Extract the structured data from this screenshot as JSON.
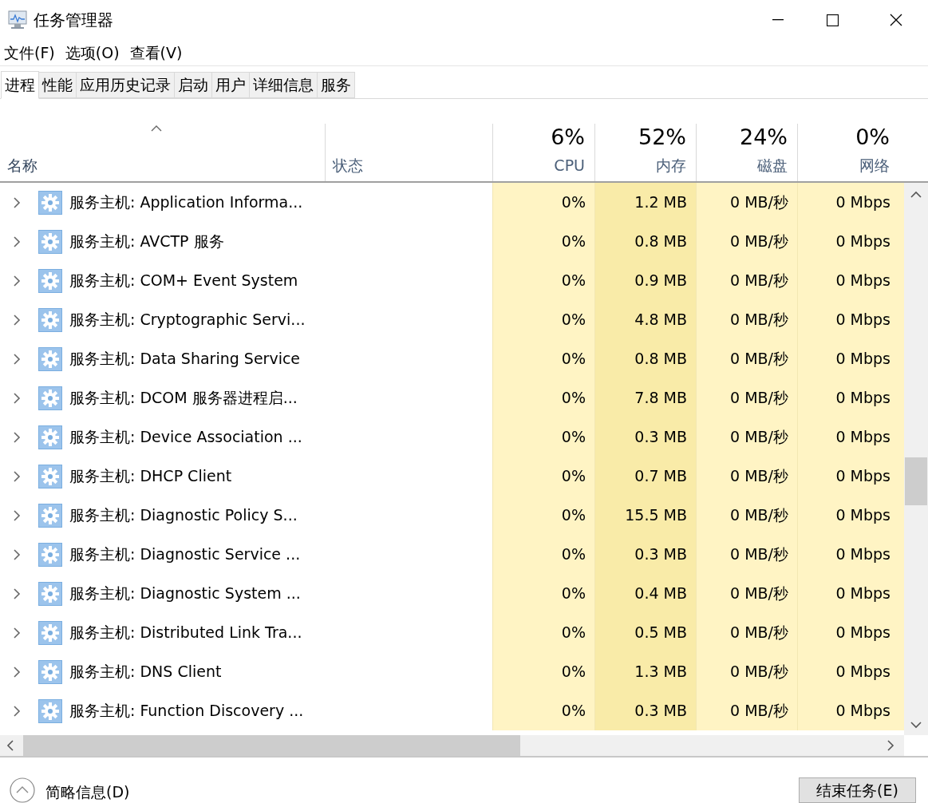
{
  "window": {
    "title": "任务管理器"
  },
  "menu": [
    "文件(F)",
    "选项(O)",
    "查看(V)"
  ],
  "tabs": [
    {
      "label": "进程",
      "selected": true
    },
    {
      "label": "性能",
      "selected": false
    },
    {
      "label": "应用历史记录",
      "selected": false
    },
    {
      "label": "启动",
      "selected": false
    },
    {
      "label": "用户",
      "selected": false
    },
    {
      "label": "详细信息",
      "selected": false
    },
    {
      "label": "服务",
      "selected": false
    }
  ],
  "columns": [
    {
      "kind": "name",
      "label": "名称",
      "sorted": true
    },
    {
      "kind": "status",
      "label": "状态",
      "sorted": false
    },
    {
      "kind": "metric",
      "total": "6%",
      "label": "CPU",
      "sorted": false,
      "color": "#fff4c4"
    },
    {
      "kind": "metric",
      "total": "52%",
      "label": "内存",
      "sorted": false,
      "color": "#f9eba8"
    },
    {
      "kind": "metric",
      "total": "24%",
      "label": "磁盘",
      "sorted": false,
      "color": "#fff4c4"
    },
    {
      "kind": "metric",
      "total": "0%",
      "label": "网络",
      "sorted": false,
      "color": "#fff4c4"
    }
  ],
  "rows": [
    {
      "name": "服务主机: Application Informa...",
      "expanded": false,
      "cells": [
        "0%",
        "1.2 MB",
        "0 MB/秒",
        "0 Mbps"
      ]
    },
    {
      "name": "服务主机: AVCTP 服务",
      "expanded": false,
      "cells": [
        "0%",
        "0.8 MB",
        "0 MB/秒",
        "0 Mbps"
      ]
    },
    {
      "name": "服务主机: COM+ Event System",
      "expanded": false,
      "cells": [
        "0%",
        "0.9 MB",
        "0 MB/秒",
        "0 Mbps"
      ]
    },
    {
      "name": "服务主机: Cryptographic Servi...",
      "expanded": false,
      "cells": [
        "0%",
        "4.8 MB",
        "0 MB/秒",
        "0 Mbps"
      ]
    },
    {
      "name": "服务主机: Data Sharing Service",
      "expanded": false,
      "cells": [
        "0%",
        "0.8 MB",
        "0 MB/秒",
        "0 Mbps"
      ]
    },
    {
      "name": "服务主机: DCOM 服务器进程启...",
      "expanded": false,
      "cells": [
        "0%",
        "7.8 MB",
        "0 MB/秒",
        "0 Mbps"
      ]
    },
    {
      "name": "服务主机: Device Association ...",
      "expanded": false,
      "cells": [
        "0%",
        "0.3 MB",
        "0 MB/秒",
        "0 Mbps"
      ]
    },
    {
      "name": "服务主机: DHCP Client",
      "expanded": false,
      "cells": [
        "0%",
        "0.7 MB",
        "0 MB/秒",
        "0 Mbps"
      ]
    },
    {
      "name": "服务主机: Diagnostic Policy S...",
      "expanded": false,
      "cells": [
        "0%",
        "15.5 MB",
        "0 MB/秒",
        "0 Mbps"
      ]
    },
    {
      "name": "服务主机: Diagnostic Service ...",
      "expanded": false,
      "cells": [
        "0%",
        "0.3 MB",
        "0 MB/秒",
        "0 Mbps"
      ]
    },
    {
      "name": "服务主机: Diagnostic System ...",
      "expanded": false,
      "cells": [
        "0%",
        "0.4 MB",
        "0 MB/秒",
        "0 Mbps"
      ]
    },
    {
      "name": "服务主机: Distributed Link Tra...",
      "expanded": false,
      "cells": [
        "0%",
        "0.5 MB",
        "0 MB/秒",
        "0 Mbps"
      ]
    },
    {
      "name": "服务主机: DNS Client",
      "expanded": false,
      "cells": [
        "0%",
        "1.3 MB",
        "0 MB/秒",
        "0 Mbps"
      ]
    },
    {
      "name": "服务主机: Function Discovery ...",
      "expanded": false,
      "cells": [
        "0%",
        "0.3 MB",
        "0 MB/秒",
        "0 Mbps"
      ]
    }
  ],
  "footer": {
    "details": "简略信息(D)",
    "end_task": "结束任务(E)"
  }
}
